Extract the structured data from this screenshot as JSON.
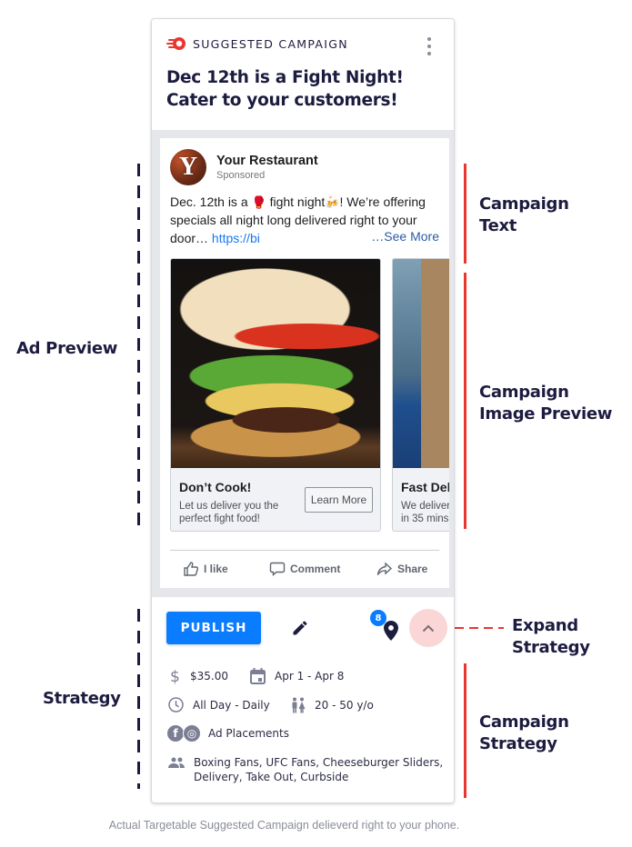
{
  "annotations": {
    "left": [
      {
        "label": "Ad Preview"
      },
      {
        "label": "Strategy"
      }
    ],
    "right": [
      {
        "label": "Campaign\nText"
      },
      {
        "label": "Campaign\nImage Preview"
      },
      {
        "label": "Expand\nStrategy"
      },
      {
        "label": "Campaign\nStrategy"
      }
    ]
  },
  "card": {
    "header": {
      "logo_icon": "flame-logo-icon",
      "eyebrow": "SUGGESTED CAMPAIGN",
      "menu_icon": "kebab-menu-icon",
      "headline_line1": "Dec 12th is a Fight Night!",
      "headline_line2": "Cater to your customers!"
    },
    "ad_preview": {
      "page_name": "Your Restaurant",
      "avatar_letter": "Y",
      "sponsored": "Sponsored",
      "text_part1": "Dec. 12th is a ",
      "emoji1": "🥊",
      "text_part2": " fight night",
      "emoji2": "🍻",
      "text_part3": "! We’re offering specials all night long delivered right to your door… ",
      "link": "https://bi",
      "see_more": "…See More",
      "carousel": [
        {
          "title": "Don’t Cook!",
          "description": "Let us deliver you the perfect fight food!",
          "cta": "Learn More",
          "image": "cheeseburger"
        },
        {
          "title": "Fast Del",
          "description_line1": "We deliver",
          "description_line2": "in 35 mins",
          "image": "takeout-bag"
        }
      ],
      "actions": [
        {
          "label": "I like",
          "icon": "thumbs-up-icon"
        },
        {
          "label": "Comment",
          "icon": "comment-icon"
        },
        {
          "label": "Share",
          "icon": "share-icon"
        }
      ]
    },
    "action_bar": {
      "publish": "PUBLISH",
      "edit_icon": "pencil-icon",
      "location_count": "8",
      "location_icon": "map-pin-icon",
      "expand_icon": "chevron-up-icon"
    },
    "strategy": {
      "budget": "$35.00",
      "dates": "Apr 1 - Apr 8",
      "schedule": "All Day - Daily",
      "age": "20 - 50 y/o",
      "placements": "Ad Placements",
      "placement_icons": [
        "f",
        "◎"
      ],
      "audience": "Boxing Fans, UFC Fans, Cheeseburger Sliders, Delivery, Take Out, Curbside"
    }
  },
  "caption": "Actual Targetable Suggested Campaign delieverd right to your phone.",
  "colors": {
    "primary": "#0a7cff",
    "accent_red": "#e8372f",
    "navy": "#1d1b3f",
    "expand_bg": "#fbd6d6"
  }
}
